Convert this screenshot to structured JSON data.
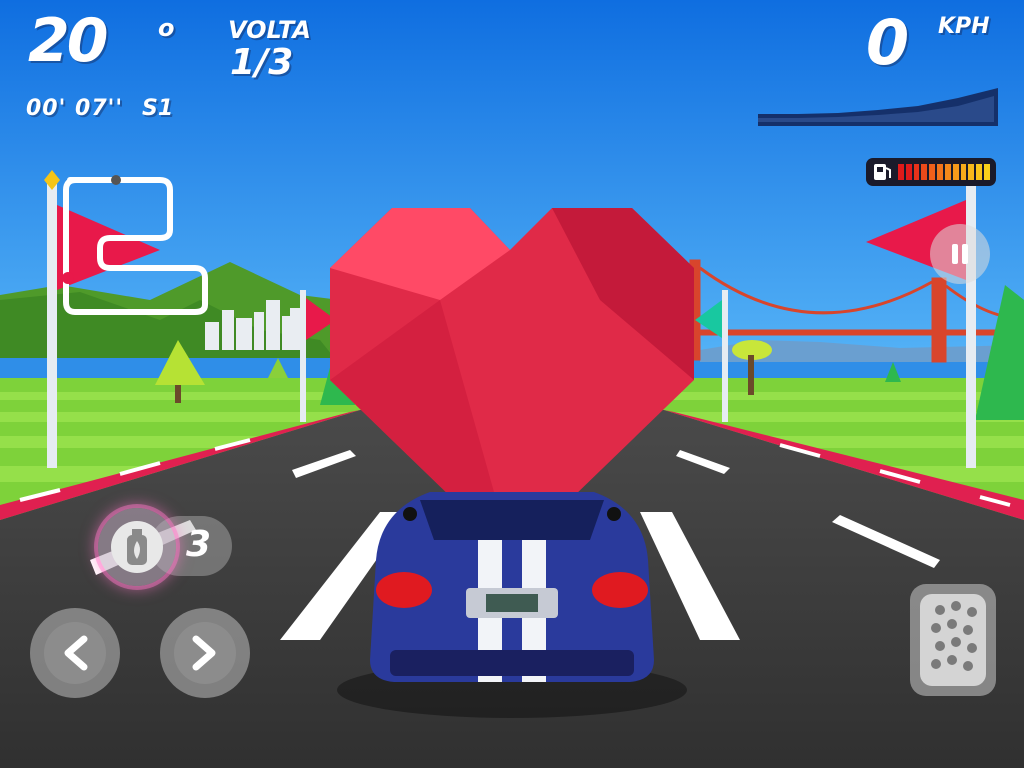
{
  "hud": {
    "position": "20",
    "position_suffix": "o",
    "lap_label": "VOLTA",
    "lap_value": "1/3",
    "lap_time": "00' 07''",
    "sector": "S1",
    "speed_value": "0",
    "speed_unit": "KPH",
    "fuel_level_fraction": 1.0,
    "nitro_count": "3"
  },
  "icons": {
    "pause": "pause-icon",
    "nitro": "nitro-bottle-icon",
    "left": "chevron-left-icon",
    "right": "chevron-right-icon",
    "accelerator": "pedal-icon",
    "fuel": "fuel-pump-icon",
    "minimap": "track-minimap-icon",
    "powerup": "heart-powerup-icon"
  },
  "colors": {
    "sky": "#1f7fe6",
    "grass": "#7ed23a",
    "road": "#3c3c3c",
    "flag": "#e8194a",
    "heart": "#e02a48",
    "car": "#2a3a9c"
  }
}
